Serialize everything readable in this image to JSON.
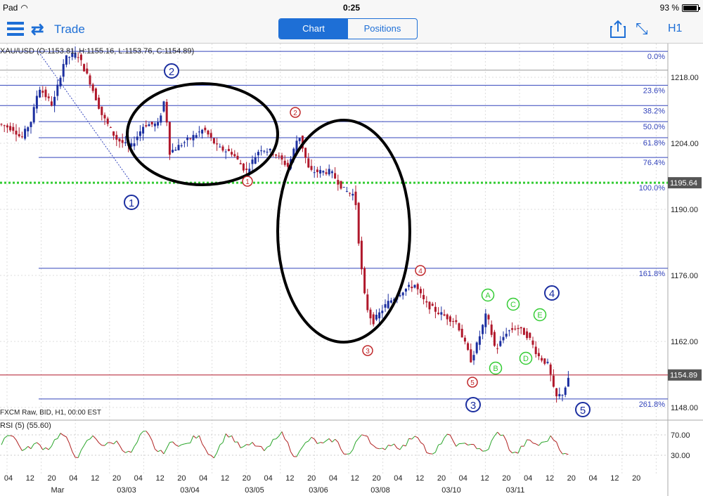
{
  "status": {
    "device": "Pad",
    "time": "0:25",
    "battery": "93 %"
  },
  "nav": {
    "trade_label": "Trade",
    "tabs": [
      "Chart",
      "Positions"
    ],
    "active_tab": "Chart",
    "timeframe": "H1"
  },
  "colors": {
    "accent": "#1e6fd6",
    "bull": "#1c2fa0",
    "bear": "#b0182b",
    "fib": "#3344bb",
    "price_line": "#b0182b",
    "support": "#33cc33",
    "rsi_up": "#2aa52a",
    "rsi_down": "#b02020"
  },
  "chart_header": {
    "symbol_ohlc": "XAU/USD (O:1153.81, H:1155.16, L:1153.76, C:1154.89)",
    "source": "FXCM Raw, BID, H1, 00:00 EST"
  },
  "rsi": {
    "label": "RSI (5)",
    "value": "(55.60)",
    "ticks": [
      "70.00",
      "30.00"
    ]
  },
  "chart_data": {
    "type": "candlestick",
    "symbol": "XAU/USD",
    "ylim": [
      1144,
      1228
    ],
    "y_ticks": [
      "1218.00",
      "1204.00",
      "1190.00",
      "1176.00",
      "1162.00",
      "1148.00"
    ],
    "x_ticks": [
      "04",
      "12",
      "20",
      "04",
      "12",
      "20",
      "04",
      "12",
      "20",
      "04",
      "12",
      "20",
      "04",
      "12",
      "20",
      "04",
      "12",
      "20",
      "04",
      "12",
      "20",
      "04",
      "12",
      "20",
      "04",
      "12",
      "20",
      "04",
      "12",
      "20"
    ],
    "date_labels": [
      "Mar",
      "03/03",
      "03/04",
      "03/05",
      "03/06",
      "03/08",
      "03/10",
      "03/11"
    ],
    "price_marker": "1154.89",
    "support_marker": "1195.64",
    "fib_levels_top": [
      {
        "label": "0.0%",
        "price": 1223.5
      },
      {
        "label": "23.6%",
        "price": 1216.3
      },
      {
        "label": "38.2%",
        "price": 1212.0
      },
      {
        "label": "50.0%",
        "price": 1208.6
      },
      {
        "label": "61.8%",
        "price": 1205.2
      },
      {
        "label": "76.4%",
        "price": 1201.0
      },
      {
        "label": "100.0%",
        "price": 1195.64
      }
    ],
    "fib_levels_ext": [
      {
        "label": "161.8%",
        "price": 1177.5
      },
      {
        "label": "261.8%",
        "price": 1149.8
      }
    ],
    "wave_labels_primary": [
      "1",
      "2",
      "3",
      "4",
      "5"
    ],
    "wave_labels_minor": [
      "1",
      "2",
      "3",
      "4",
      "5"
    ],
    "wave_labels_sub": [
      "A",
      "B",
      "C",
      "D",
      "E"
    ]
  }
}
